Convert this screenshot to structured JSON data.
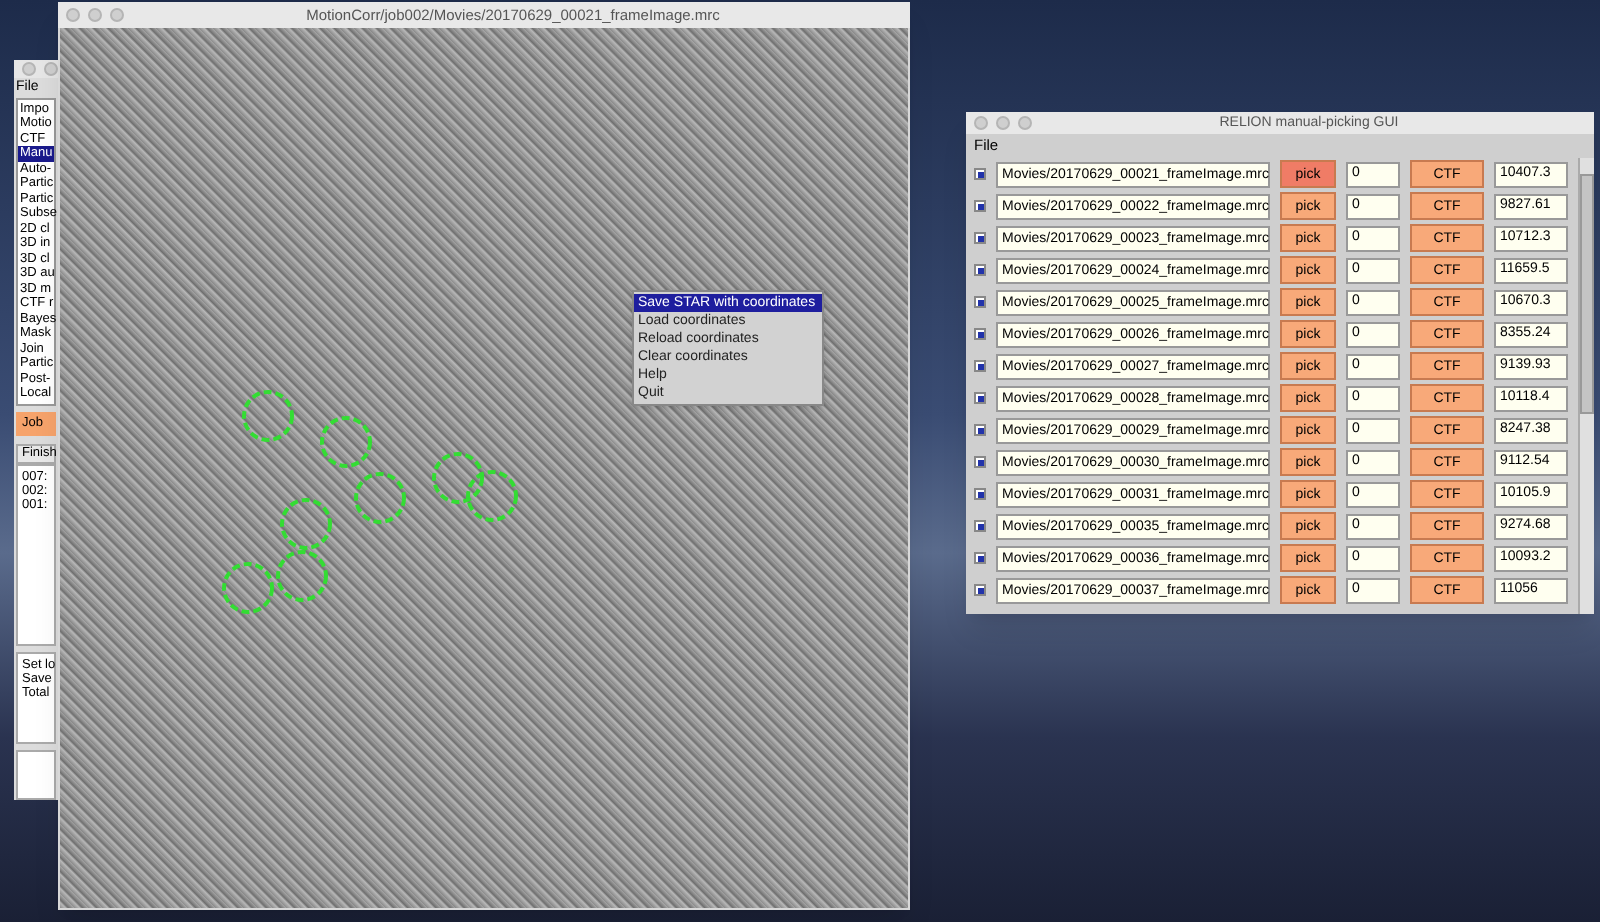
{
  "left_window": {
    "menu": [
      "File"
    ],
    "job_types": [
      {
        "label": "Impo",
        "selected": false
      },
      {
        "label": "Motio",
        "selected": false
      },
      {
        "label": "CTF",
        "selected": false
      },
      {
        "label": "Manu",
        "selected": true
      },
      {
        "label": "Auto-",
        "selected": false
      },
      {
        "label": "Partic",
        "selected": false
      },
      {
        "label": "Partic",
        "selected": false
      },
      {
        "label": "Subse",
        "selected": false
      },
      {
        "label": "2D cl",
        "selected": false
      },
      {
        "label": "3D in",
        "selected": false
      },
      {
        "label": "3D cl",
        "selected": false
      },
      {
        "label": "3D au",
        "selected": false
      },
      {
        "label": "3D m",
        "selected": false
      },
      {
        "label": "CTF r",
        "selected": false
      },
      {
        "label": "Bayes",
        "selected": false
      },
      {
        "label": "Mask",
        "selected": false
      },
      {
        "label": "Join",
        "selected": false
      },
      {
        "label": "Partic",
        "selected": false
      },
      {
        "label": "Post-",
        "selected": false
      },
      {
        "label": "Local",
        "selected": false
      }
    ],
    "job_button": "Job",
    "finished_tab": "Finish",
    "finished_jobs": [
      "007:",
      "002:",
      "001:"
    ],
    "log_lines": [
      "Set lo",
      "Save",
      "Total"
    ]
  },
  "micrograph_window": {
    "title": "MotionCorr/job002/Movies/20170629_00021_frameImage.mrc",
    "context_menu": [
      {
        "label": "Save STAR with coordinates",
        "selected": true
      },
      {
        "label": "Load coordinates",
        "selected": false
      },
      {
        "label": "Reload coordinates",
        "selected": false
      },
      {
        "label": "Clear coordinates",
        "selected": false
      },
      {
        "label": "Help",
        "selected": false
      },
      {
        "label": "Quit",
        "selected": false
      }
    ]
  },
  "picking_window": {
    "title": "RELION manual-picking GUI",
    "menu": [
      "File"
    ],
    "rows": [
      {
        "checked": true,
        "file": "Movies/20170629_00021_frameImage.mrc",
        "pick": "pick",
        "selected": true,
        "count": "0",
        "ctf": "CTF",
        "defocus": "10407.3"
      },
      {
        "checked": true,
        "file": "Movies/20170629_00022_frameImage.mrc",
        "pick": "pick",
        "selected": false,
        "count": "0",
        "ctf": "CTF",
        "defocus": "9827.61"
      },
      {
        "checked": true,
        "file": "Movies/20170629_00023_frameImage.mrc",
        "pick": "pick",
        "selected": false,
        "count": "0",
        "ctf": "CTF",
        "defocus": "10712.3"
      },
      {
        "checked": true,
        "file": "Movies/20170629_00024_frameImage.mrc",
        "pick": "pick",
        "selected": false,
        "count": "0",
        "ctf": "CTF",
        "defocus": "11659.5"
      },
      {
        "checked": true,
        "file": "Movies/20170629_00025_frameImage.mrc",
        "pick": "pick",
        "selected": false,
        "count": "0",
        "ctf": "CTF",
        "defocus": "10670.3"
      },
      {
        "checked": true,
        "file": "Movies/20170629_00026_frameImage.mrc",
        "pick": "pick",
        "selected": false,
        "count": "0",
        "ctf": "CTF",
        "defocus": "8355.24"
      },
      {
        "checked": true,
        "file": "Movies/20170629_00027_frameImage.mrc",
        "pick": "pick",
        "selected": false,
        "count": "0",
        "ctf": "CTF",
        "defocus": "9139.93"
      },
      {
        "checked": true,
        "file": "Movies/20170629_00028_frameImage.mrc",
        "pick": "pick",
        "selected": false,
        "count": "0",
        "ctf": "CTF",
        "defocus": "10118.4"
      },
      {
        "checked": true,
        "file": "Movies/20170629_00029_frameImage.mrc",
        "pick": "pick",
        "selected": false,
        "count": "0",
        "ctf": "CTF",
        "defocus": "8247.38"
      },
      {
        "checked": true,
        "file": "Movies/20170629_00030_frameImage.mrc",
        "pick": "pick",
        "selected": false,
        "count": "0",
        "ctf": "CTF",
        "defocus": "9112.54"
      },
      {
        "checked": true,
        "file": "Movies/20170629_00031_frameImage.mrc",
        "pick": "pick",
        "selected": false,
        "count": "0",
        "ctf": "CTF",
        "defocus": "10105.9"
      },
      {
        "checked": true,
        "file": "Movies/20170629_00035_frameImage.mrc",
        "pick": "pick",
        "selected": false,
        "count": "0",
        "ctf": "CTF",
        "defocus": "9274.68"
      },
      {
        "checked": true,
        "file": "Movies/20170629_00036_frameImage.mrc",
        "pick": "pick",
        "selected": false,
        "count": "0",
        "ctf": "CTF",
        "defocus": "10093.2"
      },
      {
        "checked": true,
        "file": "Movies/20170629_00037_frameImage.mrc",
        "pick": "pick",
        "selected": false,
        "count": "0",
        "ctf": "CTF",
        "defocus": "11056"
      }
    ]
  }
}
